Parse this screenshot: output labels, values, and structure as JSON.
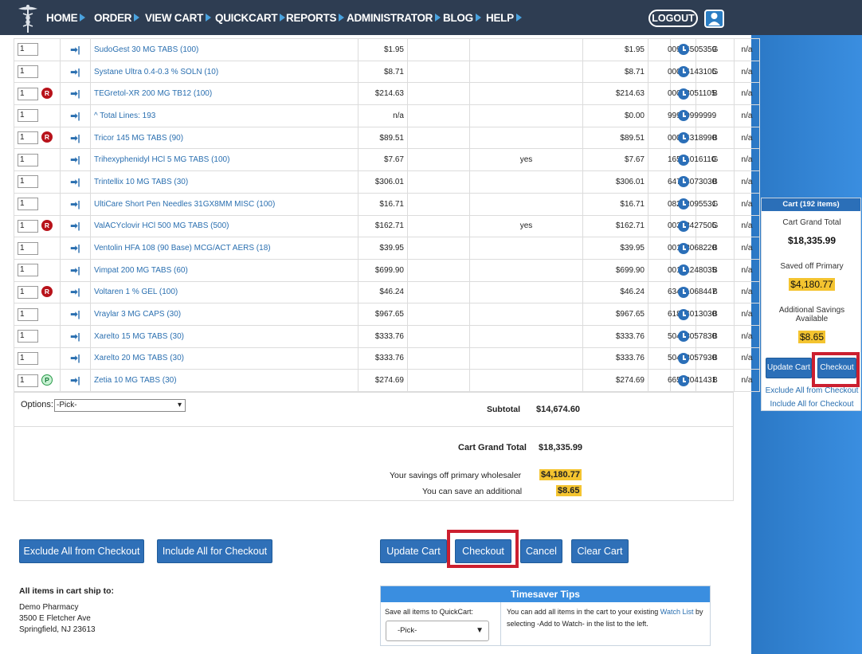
{
  "nav": {
    "items": [
      "HOME",
      "ORDER",
      "VIEW CART",
      "QUICKCART",
      "REPORTS",
      "ADMINISTRATOR",
      "BLOG",
      "HELP"
    ],
    "logout": "LOGOUT"
  },
  "rows": [
    {
      "qty": "1",
      "badge": "",
      "name": "SudoGest 30 MG TABS (100)",
      "price": "$1.95",
      "alt": "",
      "ext": "$1.95",
      "ndc": "00904505359",
      "type": "G",
      "last": "n/a"
    },
    {
      "qty": "1",
      "badge": "",
      "name": "Systane Ultra 0.4-0.3 % SOLN (10)",
      "price": "$8.71",
      "alt": "",
      "ext": "$8.71",
      "ndc": "00065143105",
      "type": "G",
      "last": "n/a"
    },
    {
      "qty": "1",
      "badge": "R",
      "name": "TEGretol-XR 200 MG TB12 (100)",
      "price": "$214.63",
      "alt": "",
      "ext": "$214.63",
      "ndc": "00078051105",
      "type": "B",
      "last": "n/a"
    },
    {
      "qty": "1",
      "badge": "",
      "name": "^ Total Lines: 193",
      "price": "n/a",
      "alt": "",
      "ext": "$0.00",
      "ndc": "99999999999",
      "type": "",
      "last": "n/a"
    },
    {
      "qty": "1",
      "badge": "R",
      "name": "Tricor 145 MG TABS (90)",
      "price": "$89.51",
      "alt": "",
      "ext": "$89.51",
      "ndc": "00074318990",
      "type": "B",
      "last": "n/a"
    },
    {
      "qty": "1",
      "badge": "",
      "name": "Trihexyphenidyl HCl 5 MG TABS (100)",
      "price": "$7.67",
      "alt": "yes",
      "ext": "$7.67",
      "ndc": "16571016110",
      "type": "G",
      "last": "n/a"
    },
    {
      "qty": "1",
      "badge": "",
      "name": "Trintellix 10 MG TABS (30)",
      "price": "$306.01",
      "alt": "",
      "ext": "$306.01",
      "ndc": "64764073030",
      "type": "B",
      "last": "n/a"
    },
    {
      "qty": "1",
      "badge": "",
      "name": "UltiCare Short Pen Needles 31GX8MM MISC (100)",
      "price": "$16.71",
      "alt": "",
      "ext": "$16.71",
      "ndc": "08222095531",
      "type": "G",
      "last": "n/a"
    },
    {
      "qty": "1",
      "badge": "R",
      "name": "ValACYclovir HCl 500 MG TABS (500)",
      "price": "$162.71",
      "alt": "yes",
      "ext": "$162.71",
      "ndc": "00378427505",
      "type": "G",
      "last": "n/a"
    },
    {
      "qty": "1",
      "badge": "",
      "name": "Ventolin HFA 108 (90 Base) MCG/ACT AERS (18)",
      "price": "$39.95",
      "alt": "",
      "ext": "$39.95",
      "ndc": "00173068220",
      "type": "B",
      "last": "n/a"
    },
    {
      "qty": "1",
      "badge": "",
      "name": "Vimpat 200 MG TABS (60)",
      "price": "$699.90",
      "alt": "",
      "ext": "$699.90",
      "ndc": "00131248035",
      "type": "B",
      "last": "n/a"
    },
    {
      "qty": "1",
      "badge": "R",
      "name": "Voltaren 1 % GEL (100)",
      "price": "$46.24",
      "alt": "",
      "ext": "$46.24",
      "ndc": "63481068447",
      "type": "B",
      "last": "n/a"
    },
    {
      "qty": "1",
      "badge": "",
      "name": "Vraylar 3 MG CAPS (30)",
      "price": "$967.65",
      "alt": "",
      "ext": "$967.65",
      "ndc": "61874013030",
      "type": "B",
      "last": "n/a"
    },
    {
      "qty": "1",
      "badge": "",
      "name": "Xarelto 15 MG TABS (30)",
      "price": "$333.76",
      "alt": "",
      "ext": "$333.76",
      "ndc": "50458057830",
      "type": "B",
      "last": "n/a"
    },
    {
      "qty": "1",
      "badge": "",
      "name": "Xarelto 20 MG TABS (30)",
      "price": "$333.76",
      "alt": "",
      "ext": "$333.76",
      "ndc": "50458057930",
      "type": "B",
      "last": "n/a"
    },
    {
      "qty": "1",
      "badge": "P",
      "name": "Zetia 10 MG TABS (30)",
      "price": "$274.69",
      "alt": "",
      "ext": "$274.69",
      "ndc": "66582041431",
      "type": "B",
      "last": "n/a"
    }
  ],
  "options": {
    "label": "Options:",
    "value": "-Pick-"
  },
  "subtotal": {
    "label": "Subtotal",
    "value": "$14,674.60"
  },
  "totals": {
    "grand_label": "Cart Grand Total",
    "grand_value": "$18,335.99",
    "savings_label": "Your savings off primary wholesaler",
    "savings_value": "$4,180.77",
    "additional_label": "You can save an additional",
    "additional_value": "$8.65"
  },
  "buttons": {
    "exclude": "Exclude All from Checkout",
    "include": "Include All for Checkout",
    "update": "Update Cart",
    "checkout": "Checkout",
    "cancel": "Cancel",
    "clear": "Clear Cart"
  },
  "ship": {
    "title": "All items in cart ship to:",
    "name": "Demo Pharmacy",
    "street": "3500 E Fletcher Ave",
    "city": "Springfield, NJ 23613"
  },
  "tips": {
    "title": "Timesaver Tips",
    "save_label": "Save all items to QuickCart:",
    "select_value": "-Pick-",
    "text1": "You can add all items in the cart to your existing ",
    "watch_link": "Watch List",
    "text2": " by",
    "text3": "selecting -Add to Watch- in the list to the left."
  },
  "panel": {
    "header": "Cart (192 items)",
    "grand_label": "Cart Grand Total",
    "grand_value": "$18,335.99",
    "saved_label": "Saved off Primary",
    "saved_value": "$4,180.77",
    "additional_label": "Additional Savings Available",
    "additional_value": "$8.65",
    "update": "Update Cart",
    "checkout": "Checkout",
    "exclude": "Exclude All from Checkout",
    "include": "Include All for Checkout"
  },
  "colors": {
    "nav": "#2e3d52",
    "accent": "#2f70b8",
    "highlight": "#f4c430",
    "callout": "#cc1f2f"
  }
}
